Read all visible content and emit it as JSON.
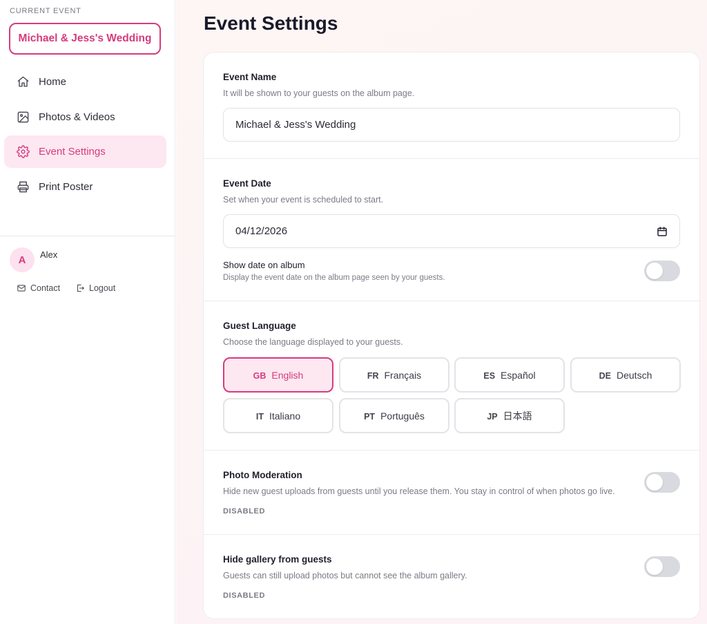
{
  "sidebar": {
    "caption": "CURRENT EVENT",
    "event_name": "Michael & Jess's Wedding",
    "nav": [
      {
        "label": "Home",
        "icon": "home-icon"
      },
      {
        "label": "Photos & Videos",
        "icon": "image-icon"
      },
      {
        "label": "Event Settings",
        "icon": "gear-icon",
        "active": true
      },
      {
        "label": "Print Poster",
        "icon": "printer-icon"
      }
    ],
    "user": {
      "initial": "A",
      "name": "Alex"
    },
    "contact_label": "Contact",
    "logout_label": "Logout"
  },
  "page": {
    "title": "Event Settings"
  },
  "event_name_section": {
    "title": "Event Name",
    "description": "It will be shown to your guests on the album page.",
    "value": "Michael & Jess's Wedding"
  },
  "event_date_section": {
    "title": "Event Date",
    "description": "Set when your event is scheduled to start.",
    "value": "04/12/2026",
    "show_date_title": "Show date on album",
    "show_date_description": "Display the event date on the album page seen by your guests.",
    "show_date_enabled": false
  },
  "language_section": {
    "title": "Guest Language",
    "description": "Choose the language displayed to your guests.",
    "options": [
      {
        "code": "GB",
        "label": "English",
        "selected": true
      },
      {
        "code": "FR",
        "label": "Français"
      },
      {
        "code": "ES",
        "label": "Español"
      },
      {
        "code": "DE",
        "label": "Deutsch"
      },
      {
        "code": "IT",
        "label": "Italiano"
      },
      {
        "code": "PT",
        "label": "Português"
      },
      {
        "code": "JP",
        "label": "日本語"
      }
    ]
  },
  "moderation_section": {
    "title": "Photo Moderation",
    "description": "Hide new guest uploads from guests until you release them. You stay in control of when photos go live.",
    "status": "DISABLED",
    "enabled": false
  },
  "hide_gallery_section": {
    "title": "Hide gallery from guests",
    "description": "Guests can still upload photos but cannot see the album gallery.",
    "status": "DISABLED",
    "enabled": false
  },
  "colors": {
    "accent": "#d63b7e",
    "accent_soft": "#fde7f1",
    "toggle_off": "#d9dadf"
  }
}
